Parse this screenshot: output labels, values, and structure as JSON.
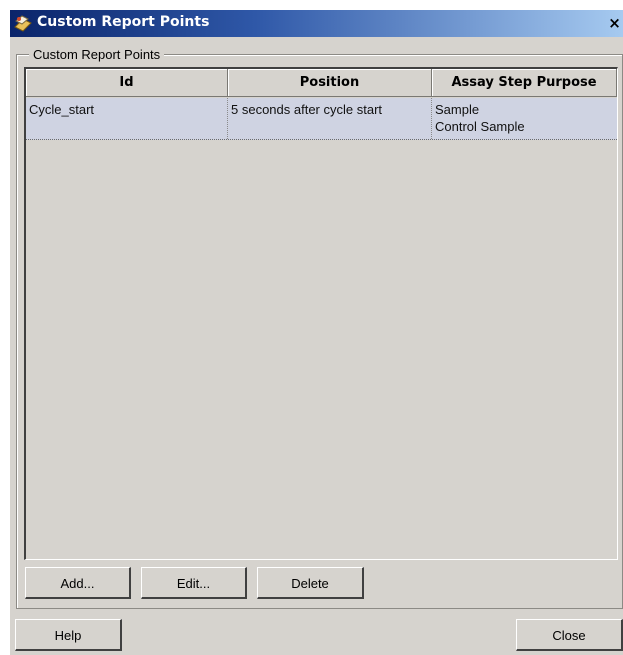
{
  "window": {
    "title": "Custom Report Points",
    "close_glyph": "×",
    "icon": "app-icon"
  },
  "group": {
    "legend": "Custom Report Points"
  },
  "table": {
    "columns": [
      "Id",
      "Position",
      "Assay Step Purpose"
    ],
    "rows": [
      {
        "id": "Cycle_start",
        "position": "5 seconds after cycle start",
        "purpose_line1": "Sample",
        "purpose_line2": "Control Sample"
      }
    ]
  },
  "buttons": {
    "add": "Add...",
    "edit": "Edit...",
    "delete": "Delete",
    "help": "Help",
    "close": "Close"
  }
}
